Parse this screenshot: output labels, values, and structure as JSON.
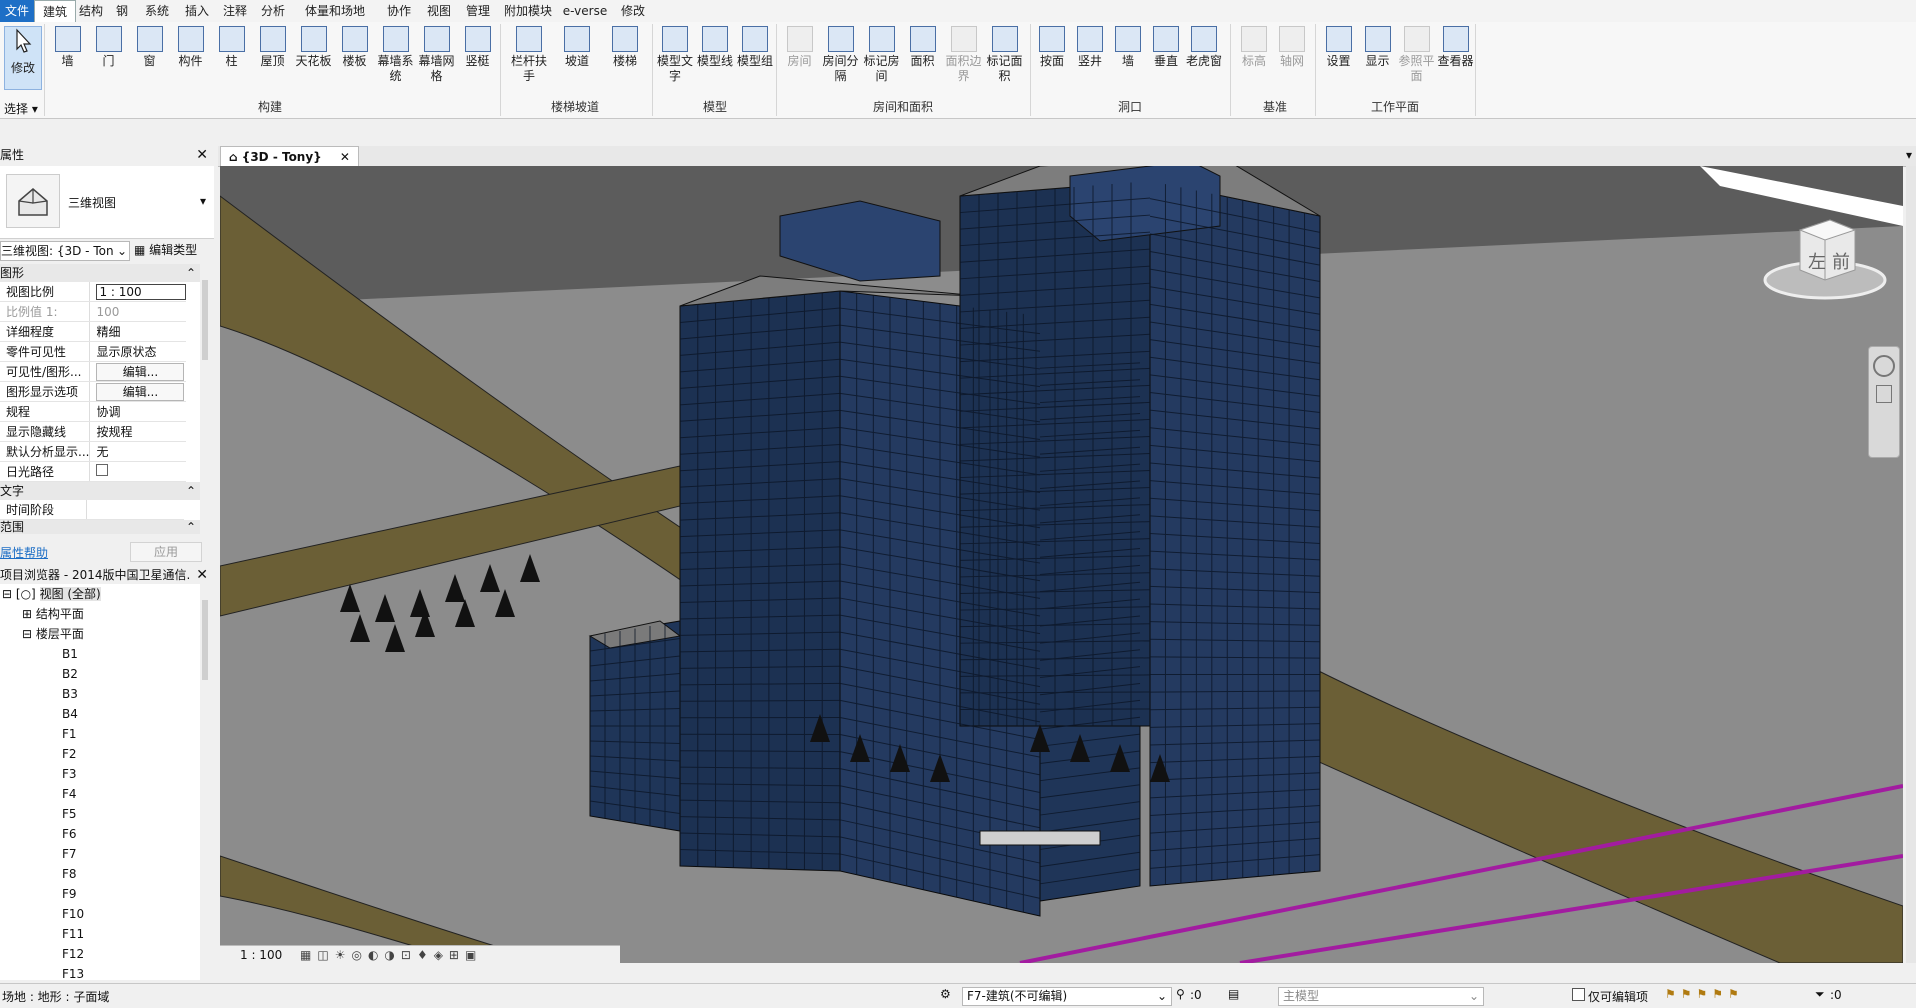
{
  "menu": {
    "tabs": [
      "文件",
      "建筑",
      "结构",
      "钢",
      "系统",
      "插入",
      "注释",
      "分析",
      "体量和场地",
      "协作",
      "视图",
      "管理",
      "附加模块",
      "e-verse",
      "修改"
    ],
    "active_tab": "建筑"
  },
  "ribbon": {
    "modify": "修改",
    "select": "选择",
    "build_buttons": [
      "墙",
      "门",
      "窗",
      "构件",
      "柱",
      "屋顶",
      "天花板",
      "楼板",
      "幕墙系统",
      "幕墙网格",
      "竖梃"
    ],
    "group_build": "构建",
    "stair_buttons": [
      "栏杆扶手",
      "坡道",
      "楼梯"
    ],
    "group_stair": "楼梯坡道",
    "model_buttons": [
      "模型文字",
      "模型线",
      "模型组"
    ],
    "group_model": "模型",
    "room_buttons": [
      "房间",
      "房间分隔",
      "标记房间",
      "面积",
      "面积边界",
      "标记面积"
    ],
    "group_room": "房间和面积",
    "opening_buttons": [
      "按面",
      "竖井",
      "墙",
      "垂直",
      "老虎窗"
    ],
    "group_opening": "洞口",
    "datum_buttons": [
      "标高",
      "轴网"
    ],
    "group_datum": "基准",
    "wp_buttons": [
      "设置",
      "显示",
      "参照平面",
      "查看器"
    ],
    "group_wp": "工作平面"
  },
  "properties": {
    "title": "属性",
    "type_name": "三维视图",
    "instance_selector": "三维视图: {3D - Ton",
    "edit_type": "编辑类型",
    "section_graphics": "图形",
    "rows": [
      {
        "label": "视图比例",
        "value": "1 : 100"
      },
      {
        "label": "比例值 1:",
        "value": "100"
      },
      {
        "label": "详细程度",
        "value": "精细"
      },
      {
        "label": "零件可见性",
        "value": "显示原状态"
      },
      {
        "label": "可见性/图形...",
        "value": "编辑..."
      },
      {
        "label": "图形显示选项",
        "value": "编辑..."
      },
      {
        "label": "规程",
        "value": "协调"
      },
      {
        "label": "显示隐藏线",
        "value": "按规程"
      },
      {
        "label": "默认分析显示...",
        "value": "无"
      },
      {
        "label": "日光路径",
        "value": ""
      }
    ],
    "section_text": "文字",
    "phase_row": {
      "label": "时间阶段",
      "value": ""
    },
    "section_range": "范围",
    "help_link": "属性帮助",
    "apply": "应用"
  },
  "browser": {
    "title": "项目浏览器 - 2014版中国卫星通信...",
    "root": "视图 (全部)",
    "structural": "结构平面",
    "floor_plans": "楼层平面",
    "levels": [
      "B1",
      "B2",
      "B3",
      "B4",
      "F1",
      "F2",
      "F3",
      "F4",
      "F5",
      "F6",
      "F7",
      "F8",
      "F9",
      "F10",
      "F11",
      "F12",
      "F13"
    ]
  },
  "view_tab": {
    "label": "{3D - Tony}"
  },
  "viewcube": {
    "left": "左",
    "front": "前"
  },
  "view_controls": {
    "scale": "1 : 100"
  },
  "status": {
    "left_text": "场地 : 地形 : 子面域",
    "workset": "F7-建筑(不可编辑)",
    "count": ":0",
    "design_option": "主模型",
    "editable_only": "仅可编辑项",
    "filter_count": ":0"
  },
  "colors": {
    "accent": "#1e6fc6",
    "viewport_bg": "#5c5c5c",
    "road": "#6b5f36",
    "ground": "#8c8c8c",
    "glass": "#1f3558",
    "magenta_line": "#a21ca0"
  }
}
